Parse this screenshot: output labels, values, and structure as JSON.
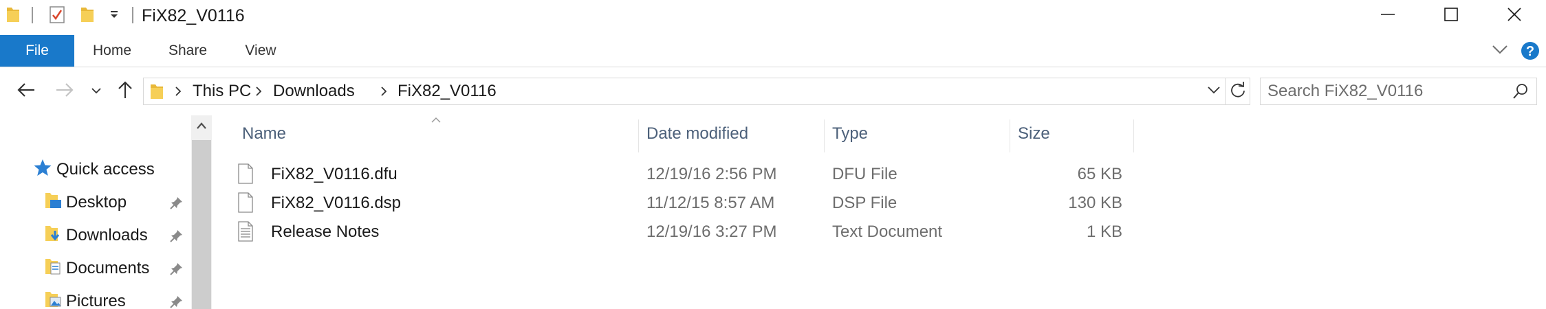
{
  "window": {
    "title": "FiX82_V0116",
    "controls": {
      "minimize_icon": "minimize-icon",
      "maximize_icon": "maximize-icon",
      "close_icon": "close-icon"
    }
  },
  "quick_access_toolbar": {
    "icons": [
      "folder-icon",
      "properties-icon",
      "new-folder-icon",
      "customize-dropdown-icon"
    ]
  },
  "ribbon": {
    "tabs": [
      {
        "label": "File",
        "active": true
      },
      {
        "label": "Home"
      },
      {
        "label": "Share"
      },
      {
        "label": "View"
      }
    ],
    "file_tab_color": "#1979ca"
  },
  "address_bar": {
    "breadcrumbs": [
      "This PC",
      "Downloads",
      "FiX82_V0116"
    ]
  },
  "search": {
    "placeholder": "Search FiX82_V0116"
  },
  "nav_pane": {
    "quick_access_label": "Quick access",
    "items": [
      {
        "label": "Desktop",
        "icon": "desktop-folder-icon",
        "pinned": true
      },
      {
        "label": "Downloads",
        "icon": "downloads-folder-icon",
        "pinned": true
      },
      {
        "label": "Documents",
        "icon": "documents-folder-icon",
        "pinned": true
      },
      {
        "label": "Pictures",
        "icon": "pictures-folder-icon",
        "pinned": true
      }
    ]
  },
  "file_list": {
    "columns": [
      "Name",
      "Date modified",
      "Type",
      "Size"
    ],
    "rows": [
      {
        "name": "FiX82_V0116.dfu",
        "date": "12/19/16 2:56 PM",
        "type": "DFU File",
        "size": "65 KB",
        "icon": "blank-file-icon"
      },
      {
        "name": "FiX82_V0116.dsp",
        "date": "11/12/15 8:57 AM",
        "type": "DSP File",
        "size": "130 KB",
        "icon": "blank-file-icon"
      },
      {
        "name": "Release Notes",
        "date": "12/19/16 3:27 PM",
        "type": "Text Document",
        "size": "1 KB",
        "icon": "text-file-icon"
      }
    ]
  },
  "colors": {
    "accent": "#1979ca",
    "header_text": "#4c607a",
    "muted_text": "#6d6d6d"
  }
}
